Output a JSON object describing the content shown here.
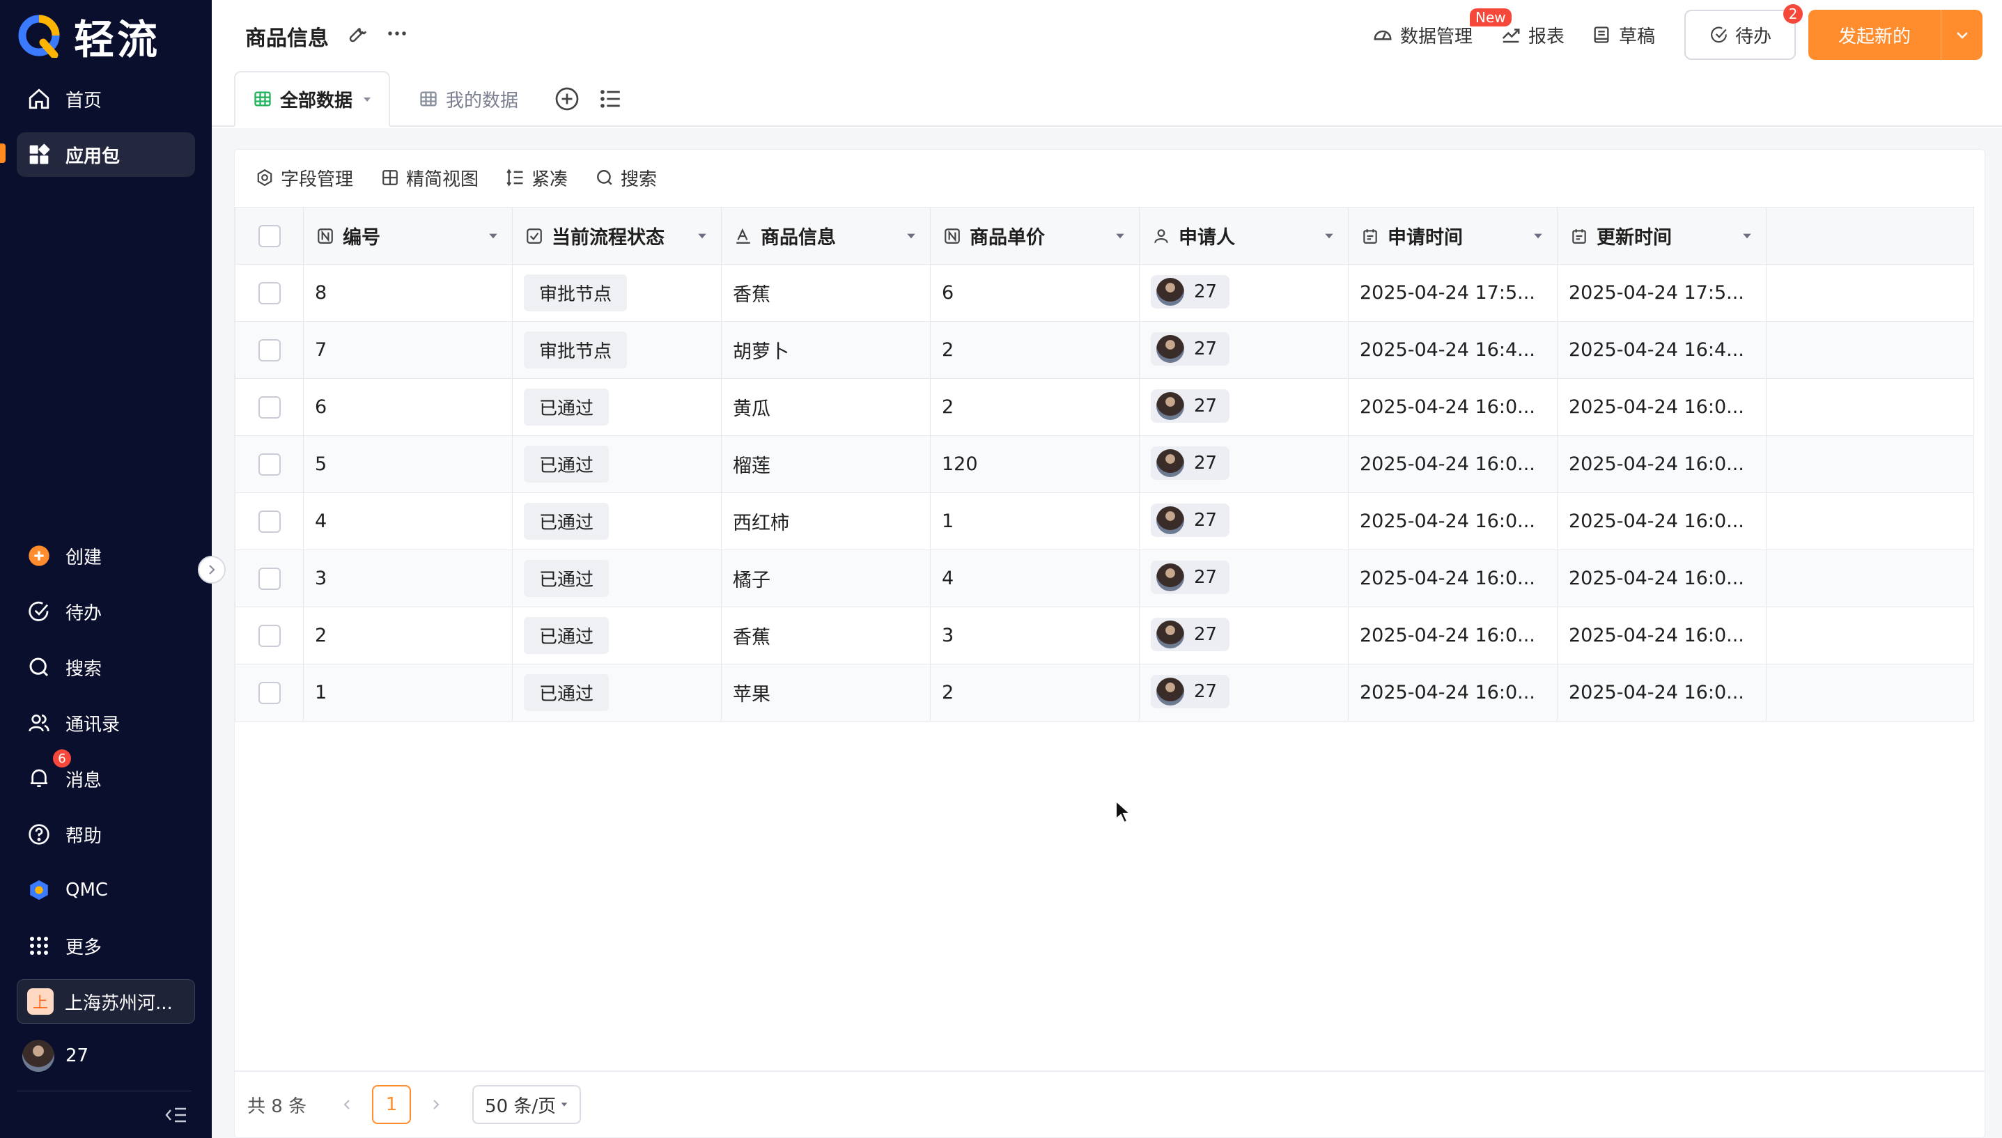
{
  "brand": {
    "name": "轻流"
  },
  "sidebar": {
    "top_items": [
      {
        "label": "首页",
        "icon": "home-icon"
      },
      {
        "label": "应用包",
        "icon": "apps-icon",
        "active": true
      }
    ],
    "bottom_items": [
      {
        "label": "创建",
        "icon": "plus-circle-icon"
      },
      {
        "label": "待办",
        "icon": "check-circle-icon"
      },
      {
        "label": "搜索",
        "icon": "search-icon"
      },
      {
        "label": "通讯录",
        "icon": "contacts-icon"
      },
      {
        "label": "消息",
        "icon": "bell-icon",
        "badge": "6"
      },
      {
        "label": "帮助",
        "icon": "help-icon"
      },
      {
        "label": "QMC",
        "icon": "qmc-icon"
      },
      {
        "label": "更多",
        "icon": "grid-icon"
      }
    ],
    "org": {
      "icon_letter": "上",
      "name": "上海苏州河..."
    },
    "user": {
      "name": "27"
    }
  },
  "header": {
    "title": "商品信息",
    "links": [
      {
        "label": "数据管理",
        "icon": "dashboard-icon",
        "badge": "New"
      },
      {
        "label": "报表",
        "icon": "chart-icon"
      },
      {
        "label": "草稿",
        "icon": "draft-icon"
      }
    ],
    "todo": {
      "label": "待办",
      "badge": "2"
    },
    "start_button": "发起新的"
  },
  "tabs": [
    {
      "label": "全部数据",
      "active": true
    },
    {
      "label": "我的数据",
      "active": false
    }
  ],
  "toolbar": [
    {
      "label": "字段管理",
      "icon": "settings-icon"
    },
    {
      "label": "精简视图",
      "icon": "layout-icon"
    },
    {
      "label": "紧凑",
      "icon": "density-icon"
    },
    {
      "label": "搜索",
      "icon": "search-icon"
    }
  ],
  "table": {
    "columns": [
      {
        "label": "编号",
        "icon": "number-field-icon"
      },
      {
        "label": "当前流程状态",
        "icon": "checkbox-field-icon"
      },
      {
        "label": "商品信息",
        "icon": "text-field-icon"
      },
      {
        "label": "商品单价",
        "icon": "number-field-icon"
      },
      {
        "label": "申请人",
        "icon": "person-field-icon"
      },
      {
        "label": "申请时间",
        "icon": "date-field-icon"
      },
      {
        "label": "更新时间",
        "icon": "date-field-icon"
      }
    ],
    "rows": [
      {
        "id": "8",
        "status": "审批节点",
        "product": "香蕉",
        "price": "6",
        "applicant": "27",
        "apply_time": "2025-04-24 17:5...",
        "update_time": "2025-04-24 17:5..."
      },
      {
        "id": "7",
        "status": "审批节点",
        "product": "胡萝卜",
        "price": "2",
        "applicant": "27",
        "apply_time": "2025-04-24 16:4...",
        "update_time": "2025-04-24 16:4..."
      },
      {
        "id": "6",
        "status": "已通过",
        "product": "黄瓜",
        "price": "2",
        "applicant": "27",
        "apply_time": "2025-04-24 16:0...",
        "update_time": "2025-04-24 16:0..."
      },
      {
        "id": "5",
        "status": "已通过",
        "product": "榴莲",
        "price": "120",
        "applicant": "27",
        "apply_time": "2025-04-24 16:0...",
        "update_time": "2025-04-24 16:0..."
      },
      {
        "id": "4",
        "status": "已通过",
        "product": "西红柿",
        "price": "1",
        "applicant": "27",
        "apply_time": "2025-04-24 16:0...",
        "update_time": "2025-04-24 16:0..."
      },
      {
        "id": "3",
        "status": "已通过",
        "product": "橘子",
        "price": "4",
        "applicant": "27",
        "apply_time": "2025-04-24 16:0...",
        "update_time": "2025-04-24 16:0..."
      },
      {
        "id": "2",
        "status": "已通过",
        "product": "香蕉",
        "price": "3",
        "applicant": "27",
        "apply_time": "2025-04-24 16:0...",
        "update_time": "2025-04-24 16:0..."
      },
      {
        "id": "1",
        "status": "已通过",
        "product": "苹果",
        "price": "2",
        "applicant": "27",
        "apply_time": "2025-04-24 16:0...",
        "update_time": "2025-04-24 16:0..."
      }
    ]
  },
  "pagination": {
    "total": "共 8 条",
    "current_page": "1",
    "page_size": "50 条/页"
  },
  "colors": {
    "sidebar_bg": "#0b0f2e",
    "accent": "#ff8d2e",
    "badge_red": "#f5483b"
  }
}
